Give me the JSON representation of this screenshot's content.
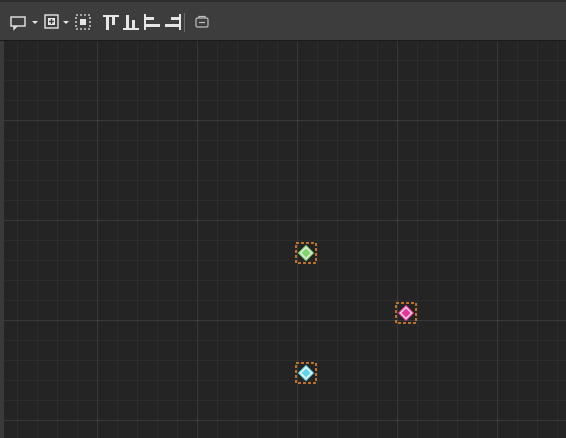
{
  "toolbar": {
    "buttons": [
      {
        "id": "comment",
        "icon": "comment-icon",
        "dropdown": true
      },
      {
        "id": "add-frame",
        "icon": "add-frame-icon",
        "dropdown": true
      },
      {
        "id": "select-all",
        "icon": "select-all-icon",
        "dropdown": false
      },
      {
        "id": "align-top",
        "icon": "align-top-icon",
        "dropdown": false
      },
      {
        "id": "align-bottom",
        "icon": "align-bottom-icon",
        "dropdown": false
      },
      {
        "id": "align-left",
        "icon": "align-left-icon",
        "dropdown": false
      },
      {
        "id": "align-right",
        "icon": "align-right-icon",
        "dropdown": false
      },
      {
        "id": "snapshot",
        "icon": "snapshot-icon",
        "dropdown": false
      }
    ]
  },
  "nodes": [
    {
      "id": "node-green",
      "color": "#7fd36b",
      "selection_color": "#f0892a"
    },
    {
      "id": "node-magenta",
      "color": "#e0389a",
      "selection_color": "#f0892a"
    },
    {
      "id": "node-cyan",
      "color": "#5fd3e8",
      "selection_color": "#f0892a"
    }
  ],
  "colors": {
    "toolbar_bg": "#3d3d3d",
    "canvas_bg": "#242424",
    "icon": "#e6e6e6",
    "selection": "#f0892a"
  }
}
